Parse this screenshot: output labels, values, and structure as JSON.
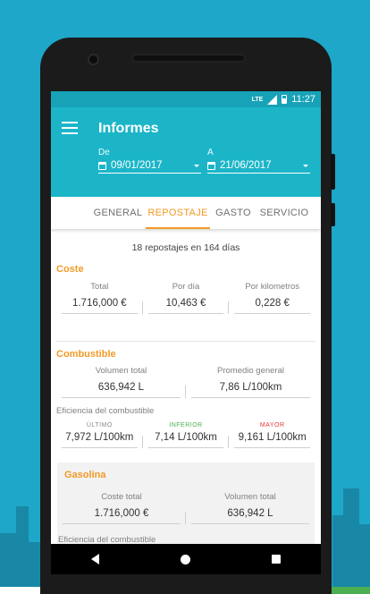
{
  "status_bar": {
    "network": "LTE",
    "time": "11:27"
  },
  "app_bar": {
    "title": "Informes",
    "from_label": "De",
    "from_date": "09/01/2017",
    "to_label": "A",
    "to_date": "21/06/2017"
  },
  "tabs": [
    {
      "label": "GENERAL",
      "active": false
    },
    {
      "label": "REPOSTAJE",
      "active": true
    },
    {
      "label": "GASTO",
      "active": false
    },
    {
      "label": "SERVICIO",
      "active": false
    }
  ],
  "summary": "18 repostajes en 164 días",
  "coste": {
    "title": "Coste",
    "items": [
      {
        "label": "Total",
        "value": "1.716,000 €"
      },
      {
        "label": "Por día",
        "value": "10,463 €"
      },
      {
        "label": "Por kilometros",
        "value": "0,228 €"
      }
    ]
  },
  "combustible": {
    "title": "Combustible",
    "items": [
      {
        "label": "Volumen total",
        "value": "636,942 L"
      },
      {
        "label": "Promedio general",
        "value": "7,86 L/100km"
      }
    ],
    "efficiency_title": "Eficiencia del combustible",
    "efficiency": [
      {
        "label": "ÚLTIMO",
        "value": "7,972 L/100km",
        "color": "#8a8a8a"
      },
      {
        "label": "INFERIOR",
        "value": "7,14 L/100km",
        "color": "#4caf50"
      },
      {
        "label": "MAYOR",
        "value": "9,161 L/100km",
        "color": "#e53935"
      }
    ]
  },
  "gasolina": {
    "title": "Gasolina",
    "items": [
      {
        "label": "Coste total",
        "value": "1.716,000 €"
      },
      {
        "label": "Volumen total",
        "value": "636,942 L"
      }
    ],
    "efficiency_title": "Eficiencia del combustible"
  },
  "colors": {
    "background": "#1ea7c9",
    "app_bar": "#1cb5c8",
    "accent": "#f29a26"
  }
}
